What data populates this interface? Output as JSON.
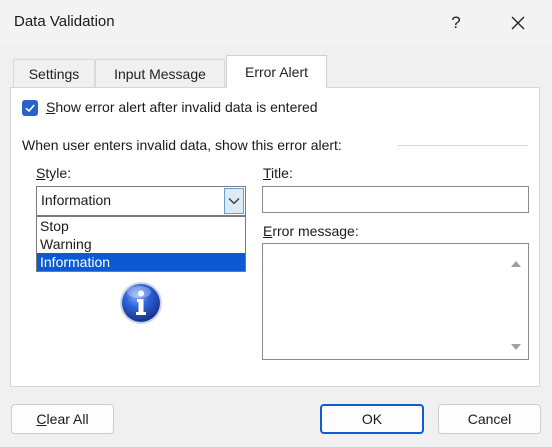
{
  "window": {
    "title": "Data Validation",
    "help_label": "?"
  },
  "tabs": [
    {
      "label": "Settings",
      "active": false
    },
    {
      "label": "Input Message",
      "active": false
    },
    {
      "label": "Error Alert",
      "active": true
    }
  ],
  "error_alert": {
    "show_checkbox": {
      "label": "Show error alert after invalid data is entered",
      "checked": true
    },
    "group_label": "When user enters invalid data, show this error alert:",
    "style": {
      "label": "Style:",
      "selected": "Information",
      "options": [
        "Stop",
        "Warning",
        "Information"
      ],
      "highlighted_option": "Information"
    },
    "title": {
      "label": "Title:",
      "value": ""
    },
    "error_message": {
      "label": "Error message:",
      "value": ""
    },
    "icon": "information-icon"
  },
  "buttons": {
    "clear_all": "Clear All",
    "ok": "OK",
    "cancel": "Cancel"
  },
  "colors": {
    "accent": "#0b5ad2",
    "checkbox": "#2a62c9"
  }
}
